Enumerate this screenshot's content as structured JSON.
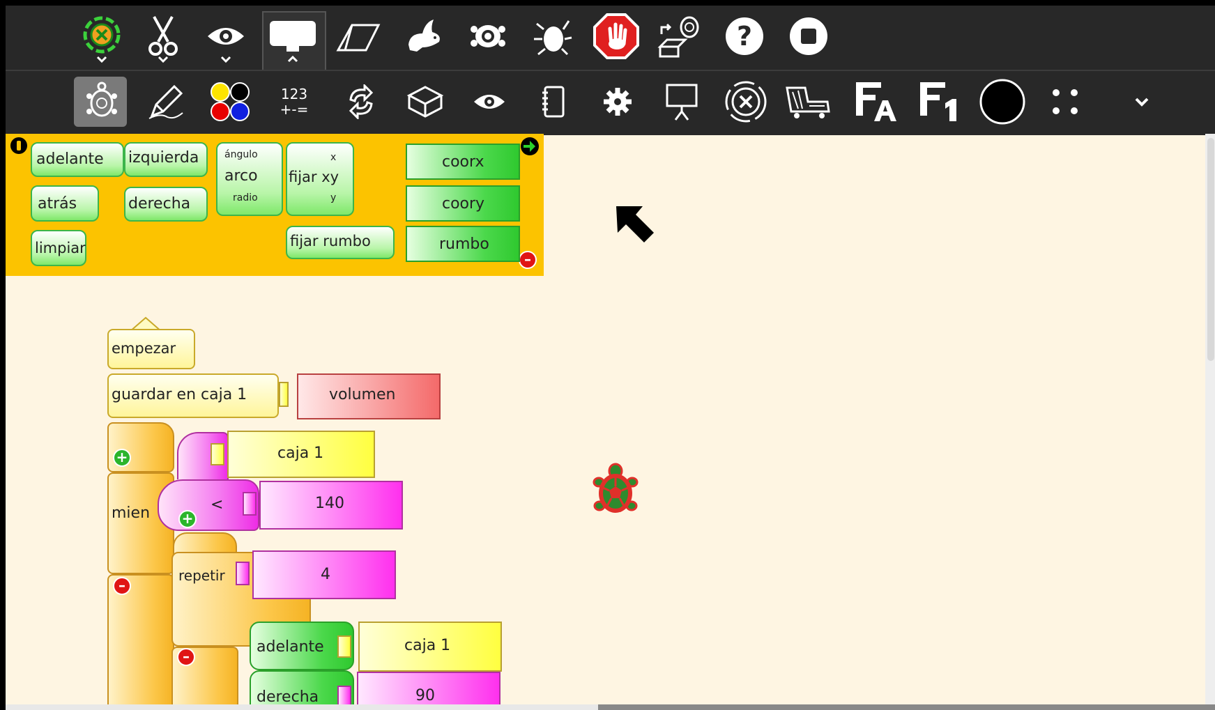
{
  "app": {
    "name": "Turtle Blocks"
  },
  "toolbar_top": {
    "icons": [
      "activity-icon",
      "cut-icon",
      "view-icon",
      "edit-toolbar-icon",
      "eraser-icon",
      "run-fast-icon",
      "run-turtle-icon",
      "debug-icon",
      "stop-hand-icon",
      "save-turtle-icon",
      "help-icon",
      "stop-icon"
    ]
  },
  "toolbar_palettes": {
    "icons": [
      "turtle-palette-icon",
      "pen-palette-icon",
      "colors-palette-icon",
      "number-palette-icon",
      "flow-palette-icon",
      "blocks-palette-icon",
      "sensors-palette-icon",
      "media-palette-icon",
      "extras-palette-icon",
      "presentation-palette-icon",
      "portfolio-palette-icon",
      "trash-icon",
      "language-icon",
      "label-icon",
      "pen-color-swatch",
      "more-icon",
      "expand-icon"
    ],
    "number_icon_line1": "123",
    "number_icon_line2": "+-=",
    "pen_color": "#000000"
  },
  "palette": {
    "bg_color": "#fcc300",
    "blocks": {
      "forward": "adelante",
      "left": "izquierda",
      "arc_angle": "ángulo",
      "arc": "arco",
      "arc_radius": "radio",
      "setxy": "fijar xy",
      "setxy_x": "x",
      "setxy_y": "y",
      "xcor": "coorx",
      "back": "atrás",
      "right": "derecha",
      "ycor": "coory",
      "clean": "limpiar",
      "setheading": "fijar rumbo",
      "heading": "rumbo"
    }
  },
  "program": {
    "start": "empezar",
    "storein": "guardar en caja 1",
    "volume": "volumen",
    "box1_a": "caja 1",
    "while": "mien",
    "less_than": "<",
    "number_140": "140",
    "repeat": "repetir",
    "number_4": "4",
    "forward": "adelante",
    "box1_b": "caja 1",
    "right": "derecha",
    "number_90": "90"
  },
  "turtle": {
    "color": "#2e8b2e",
    "outline": "#e0302a"
  }
}
